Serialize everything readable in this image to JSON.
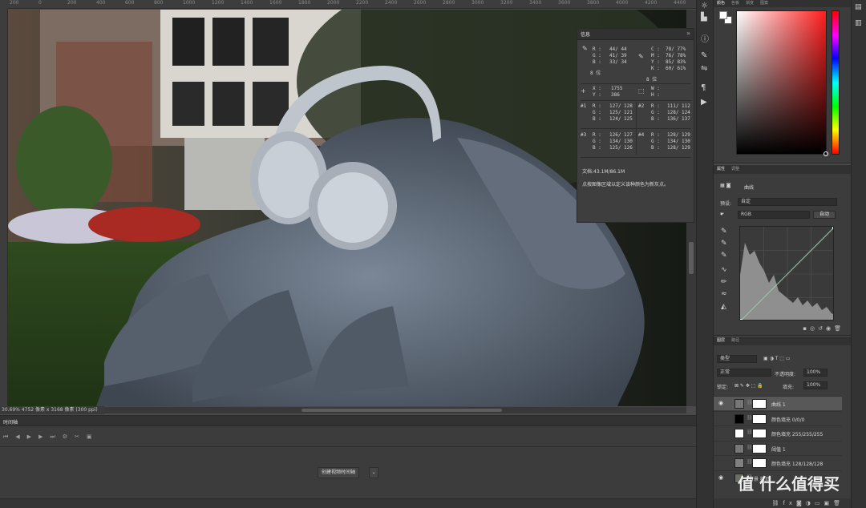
{
  "ruler": {
    "ticks": [
      "200",
      "0",
      "200",
      "400",
      "600",
      "800",
      "1000",
      "1200",
      "1400",
      "1600",
      "1800",
      "2000",
      "2200",
      "2400",
      "2600",
      "2800",
      "3000",
      "3200",
      "3400",
      "3600",
      "3800",
      "4000",
      "4200",
      "4400",
      "4600"
    ]
  },
  "status": {
    "text": "30.69%  4752 像素 x 3168 像素 (300 ppi)"
  },
  "info_panel": {
    "tab": "信息",
    "controls": "»",
    "rgb": {
      "labels": "R :\nG :\nB :",
      "values": "44/ 44\n41/ 39\n33/ 34",
      "bits": "8 位"
    },
    "cmyk": {
      "labels": "C :\nM :\nY :\nK :",
      "values": "78/ 77%\n76/ 78%\n85/ 83%\n60/ 61%",
      "bits": "8 位"
    },
    "xy": {
      "labels": "X :\nY :",
      "values": "1755\n386"
    },
    "wh": {
      "labels": "W :\nH :",
      "values": ""
    },
    "s1": {
      "id": "#1",
      "labels": "R :\nG :\nB :",
      "values": "127/ 128\n125/ 121\n124/ 125"
    },
    "s2": {
      "id": "#2",
      "labels": "R :\nG :\nB :",
      "values": "111/ 112\n128/ 124\n136/ 137"
    },
    "s3": {
      "id": "#3",
      "labels": "R :\nG :\nB :",
      "values": "126/ 127\n134/ 130\n125/ 126"
    },
    "s4": {
      "id": "#4",
      "labels": "R :\nG :\nB :",
      "values": "128/ 129\n134/ 130\n128/ 129"
    },
    "doc": "文档:43.1M/86.1M",
    "hint": "点按图像区域以定义该种颜色为新灰点。"
  },
  "timeline": {
    "tab": "时间轴",
    "create_button": "创建视频时间轴",
    "dropdown_icon": "chevron-down-icon"
  },
  "color_panel": {
    "tabs": [
      "颜色",
      "色板",
      "渐变",
      "图案"
    ],
    "active_tab": 0,
    "hue_color": "#ff1e1e"
  },
  "properties": {
    "tabs": [
      "属性",
      "调整"
    ],
    "title": "曲线",
    "preset_label": "预设:",
    "preset_value": "自定",
    "channel_value": "RGB",
    "auto_button": "自动"
  },
  "layers": {
    "tabs": [
      "图层",
      "路径"
    ],
    "filter_value": "类型",
    "blend_mode": "正常",
    "opacity_label": "不透明度:",
    "opacity_value": "100%",
    "lock_label": "锁定:",
    "fill_label": "填充:",
    "fill_value": "100%",
    "items": [
      {
        "name": "曲线 1",
        "visible": true,
        "selected": true,
        "thumb": "adj"
      },
      {
        "name": "颜色填充 0/0/0",
        "visible": false,
        "selected": false,
        "thumb": "#000000"
      },
      {
        "name": "颜色填充 255/255/255",
        "visible": false,
        "selected": false,
        "thumb": "#ffffff"
      },
      {
        "name": "阈值 1",
        "visible": false,
        "selected": false,
        "thumb": "adj"
      },
      {
        "name": "颜色填充 128/128/128",
        "visible": false,
        "selected": false,
        "thumb": "#808080"
      },
      {
        "name": "背景 拷贝",
        "visible": true,
        "selected": false,
        "thumb": "photo"
      }
    ]
  },
  "watermark": "值 什么值得买"
}
